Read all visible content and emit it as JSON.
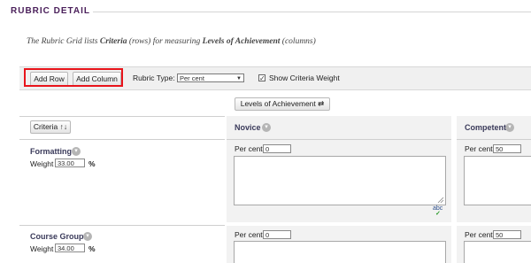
{
  "page": {
    "section_title": "RUBRIC DETAIL",
    "intro": {
      "part1": "The Rubric Grid lists ",
      "criteria": "Criteria",
      "part2": " (rows) for measuring ",
      "levels": "Levels of Achievement",
      "part3": " (columns)"
    }
  },
  "toolbar": {
    "add_row": "Add Row",
    "add_column": "Add Column",
    "rubric_type_label": "Rubric Type:",
    "rubric_type_value": "Per cent",
    "show_weight_label": "Show Criteria Weight",
    "show_weight_checked": true
  },
  "grid": {
    "levels_button": "Levels of Achievement",
    "criteria_button": "Criteria",
    "columns": [
      {
        "name": "Novice"
      },
      {
        "name": "Competent"
      }
    ],
    "rows": [
      {
        "name": "Formatting",
        "weight_label": "Weight",
        "weight_value": "33.00",
        "weight_unit": "%",
        "cells": [
          {
            "prefix": "Per cent",
            "value": "0"
          },
          {
            "prefix": "Per cent",
            "value": "50"
          }
        ]
      },
      {
        "name": "Course Group",
        "weight_label": "Weight",
        "weight_value": "34.00",
        "weight_unit": "%",
        "cells": [
          {
            "prefix": "Per cent",
            "value": "0"
          },
          {
            "prefix": "Per cent",
            "value": "50"
          }
        ]
      }
    ],
    "spellcheck_label": "abc"
  },
  "colors": {
    "title": "#4a1f5a",
    "highlight": "#e8141b"
  }
}
